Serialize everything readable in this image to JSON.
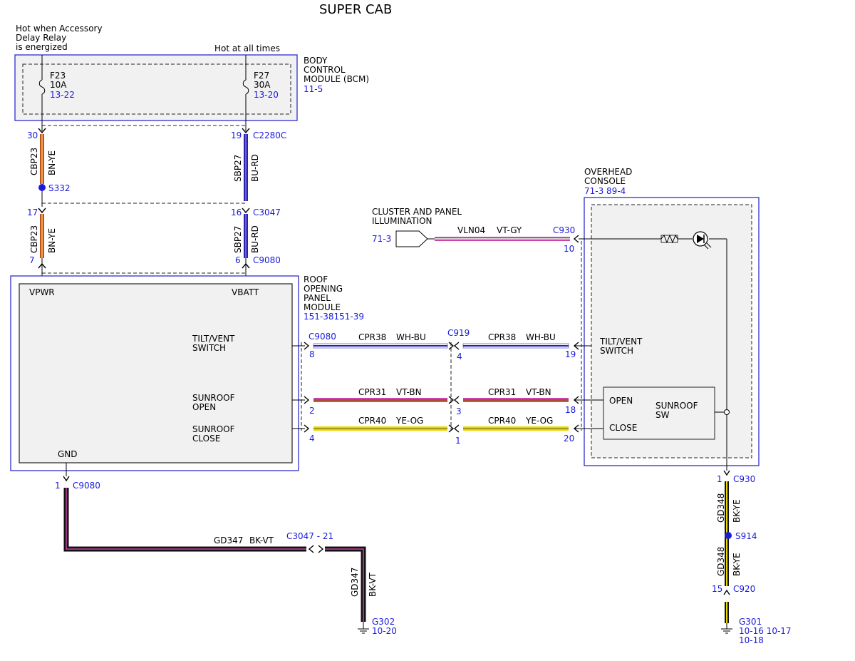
{
  "title": "SUPER CAB",
  "colors": {
    "brown": "#b8561c",
    "orange": "#f2a25a",
    "blue_wire": "#2d1fb0",
    "violet": "#cc44aa",
    "pink": "#f0a0d0",
    "white": "#ffffff",
    "wire_blue": "#7a8ac8",
    "yellow": "#e6d800",
    "olive": "#a89a10",
    "black": "#111111",
    "box_fill": "#f1f1f1",
    "box_border": "#2e2ecc",
    "ref_text": "#1a1adc"
  },
  "notes": {
    "accessory_line1": "Hot when Accessory",
    "accessory_line2": "Delay Relay",
    "accessory_line3": "is energized",
    "hot_at_all_times": "Hot at all times"
  },
  "bcm": {
    "line1": "BODY",
    "line2": "CONTROL",
    "line3": "MODULE (BCM)",
    "ref": "11-5",
    "fuse1": {
      "name": "F23",
      "rating": "10A",
      "ref": "13-22"
    },
    "fuse2": {
      "name": "F27",
      "rating": "30A",
      "ref": "13-20"
    }
  },
  "wires": {
    "cbp23": {
      "circuit": "CBP23",
      "color": "BN-YE"
    },
    "sbp27": {
      "circuit": "SBP27",
      "color": "BU-RD"
    },
    "vln04": {
      "circuit": "VLN04",
      "color": "VT-GY"
    },
    "cpr38": {
      "circuit": "CPR38",
      "color": "WH-BU"
    },
    "cpr31": {
      "circuit": "CPR31",
      "color": "VT-BN"
    },
    "cpr40": {
      "circuit": "CPR40",
      "color": "YE-OG"
    },
    "gd347": {
      "circuit": "GD347",
      "color": "BK-VT"
    },
    "gd348": {
      "circuit": "GD348",
      "color": "BK-YE"
    }
  },
  "pins": {
    "p30": "30",
    "p17": "17",
    "p7": "7",
    "p19": "19",
    "p16": "16",
    "p6": "6",
    "p10": "10",
    "p8": "8",
    "p4a": "4",
    "p19b": "19",
    "p2": "2",
    "p3": "3",
    "p18": "18",
    "p4b": "4",
    "p1": "1",
    "p20": "20",
    "p1gnd": "1",
    "p1c930": "1",
    "p15": "15"
  },
  "connectors": {
    "c2280c": "C2280C",
    "c3047": "C3047",
    "c9080": "C9080",
    "c930": "C930",
    "c919": "C919",
    "c920": "C920",
    "c3047_21": "C3047 - 21"
  },
  "splices": {
    "s332": "S332",
    "s914": "S914"
  },
  "cluster": {
    "line1": "CLUSTER AND PANEL",
    "line2": "ILLUMINATION",
    "ref": "71-3"
  },
  "overhead": {
    "line1": "OVERHEAD",
    "line2": "CONSOLE",
    "ref": "71-3  89-4"
  },
  "ropm": {
    "line1": "ROOF",
    "line2": "OPENING",
    "line3": "PANEL",
    "line4": "MODULE",
    "ref": "151-38151-39",
    "vpwr": "VPWR",
    "vbatt": "VBATT",
    "gnd": "GND",
    "tilt1": "TILT/VENT",
    "tilt2": "SWITCH",
    "open1": "SUNROOF",
    "open2": "OPEN",
    "close1": "SUNROOF",
    "close2": "CLOSE"
  },
  "console_sw": {
    "tilt1": "TILT/VENT",
    "tilt2": "SWITCH",
    "open": "OPEN",
    "close": "CLOSE",
    "sw1": "SUNROOF",
    "sw2": "SW"
  },
  "grounds": {
    "g302": {
      "name": "G302",
      "ref": "10-20"
    },
    "g301": {
      "name": "G301",
      "ref1": "10-16 10-17",
      "ref2": "10-18"
    }
  }
}
